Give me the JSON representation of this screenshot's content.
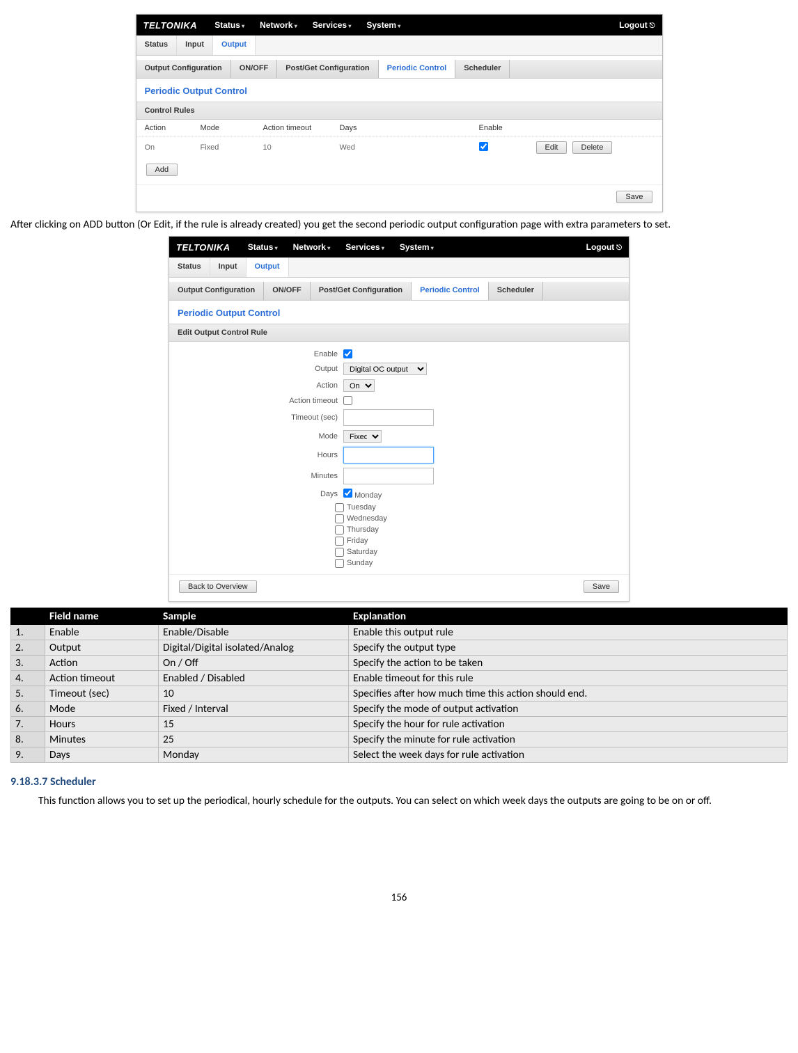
{
  "nav": {
    "logo": "TELTONIKA",
    "items": [
      "Status",
      "Network",
      "Services",
      "System"
    ],
    "logout": "Logout"
  },
  "tabs_io": [
    "Status",
    "Input",
    "Output"
  ],
  "tabs_io_active": 2,
  "tabs_cfg": [
    "Output Configuration",
    "ON/OFF",
    "Post/Get Configuration",
    "Periodic Control",
    "Scheduler"
  ],
  "tabs_cfg_active": 3,
  "section_title": "Periodic Output Control",
  "ss1": {
    "subheader": "Control Rules",
    "head": [
      "Action",
      "Mode",
      "Action timeout",
      "Days",
      "Enable"
    ],
    "row": {
      "action": "On",
      "mode": "Fixed",
      "timeout": "10",
      "days": "Wed"
    },
    "buttons": {
      "edit": "Edit",
      "delete": "Delete",
      "add": "Add",
      "save": "Save"
    }
  },
  "para1": "After clicking on ADD button (Or Edit, if the rule is already created) you get the second periodic output configuration page with extra parameters to set.",
  "ss2": {
    "subheader": "Edit Output Control Rule",
    "fields": {
      "enable": "Enable",
      "output": "Output",
      "output_val": "Digital OC output",
      "action": "Action",
      "action_val": "On",
      "action_timeout": "Action timeout",
      "timeout_sec": "Timeout (sec)",
      "mode": "Mode",
      "mode_val": "Fixed",
      "hours": "Hours",
      "minutes": "Minutes",
      "days": "Days"
    },
    "days": [
      "Monday",
      "Tuesday",
      "Wednesday",
      "Thursday",
      "Friday",
      "Saturday",
      "Sunday"
    ],
    "buttons": {
      "back": "Back to Overview",
      "save": "Save"
    }
  },
  "table": {
    "head": [
      "",
      "Field name",
      "Sample",
      "Explanation"
    ],
    "rows": [
      [
        "1.",
        "Enable",
        "Enable/Disable",
        "Enable this output rule"
      ],
      [
        "2.",
        "Output",
        "Digital/Digital isolated/Analog",
        "Specify the output type"
      ],
      [
        "3.",
        "Action",
        "On / Off",
        "Specify the action to be taken"
      ],
      [
        "4.",
        "Action timeout",
        "Enabled / Disabled",
        "Enable timeout for this rule"
      ],
      [
        "5.",
        "Timeout (sec)",
        "10",
        "Specifies after how much time this action should end."
      ],
      [
        "6.",
        "Mode",
        "Fixed / Interval",
        "Specify the mode of output activation"
      ],
      [
        "7.",
        "Hours",
        "15",
        "Specify the hour for rule activation"
      ],
      [
        "8.",
        "Minutes",
        "25",
        "Specify the minute for rule activation"
      ],
      [
        "9.",
        "Days",
        "Monday",
        "Select the week days for rule activation"
      ]
    ]
  },
  "scheduler": {
    "heading_num": "9.18.3.7",
    "heading": "Scheduler",
    "text": "This function allows you to set up the periodical, hourly schedule for the outputs. You can select on which week days the outputs are going to be on or off."
  },
  "page_number": "156"
}
